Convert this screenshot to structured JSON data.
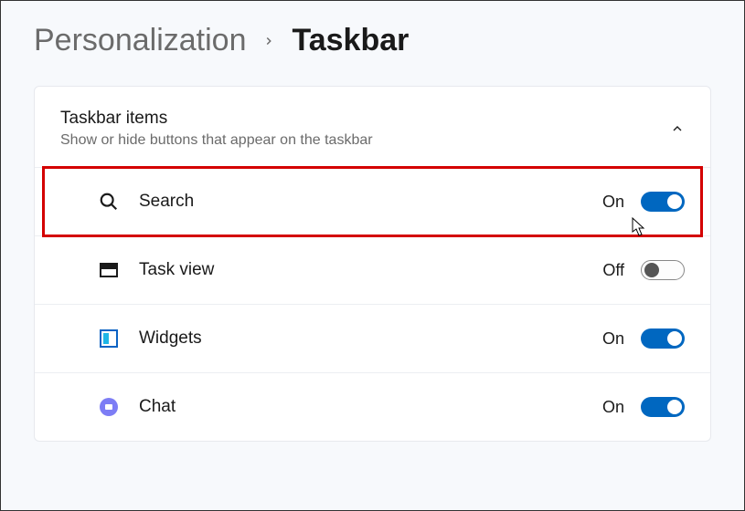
{
  "breadcrumb": {
    "parent": "Personalization",
    "current": "Taskbar"
  },
  "section": {
    "title": "Taskbar items",
    "subtitle": "Show or hide buttons that appear on the taskbar"
  },
  "items": [
    {
      "id": "search",
      "label": "Search",
      "state": "On",
      "on": true,
      "highlighted": true
    },
    {
      "id": "taskview",
      "label": "Task view",
      "state": "Off",
      "on": false,
      "highlighted": false
    },
    {
      "id": "widgets",
      "label": "Widgets",
      "state": "On",
      "on": true,
      "highlighted": false
    },
    {
      "id": "chat",
      "label": "Chat",
      "state": "On",
      "on": true,
      "highlighted": false
    }
  ]
}
